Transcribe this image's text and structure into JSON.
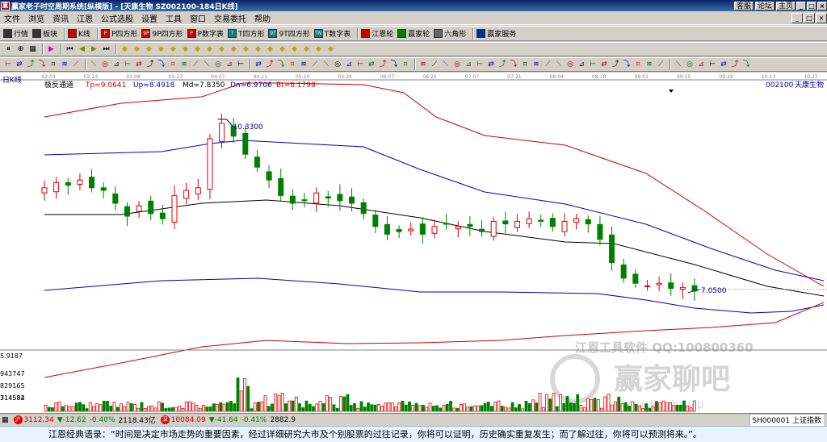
{
  "window": {
    "icon_text": "赢",
    "title": "赢家老子时空周期系统[纵横版] - [天康生物   SZ002100-184日K线]",
    "title_buttons": [
      "客服",
      "论坛",
      "主页"
    ],
    "window_controls": [
      "_",
      "□",
      "×"
    ]
  },
  "menu": {
    "items": [
      "文件",
      "浏览",
      "资讯",
      "江恩",
      "公式选股",
      "设置",
      "工具",
      "窗口",
      "交易委托",
      "帮助"
    ],
    "mdi": [
      "_",
      "□",
      "×"
    ]
  },
  "toolbar1": {
    "items": [
      {
        "label": "行情",
        "color": "#333333"
      },
      {
        "label": "板块",
        "color": "#333333"
      },
      {
        "label": "K线",
        "color": "#cc0000"
      },
      {
        "label": "P四方形",
        "color": "#cc0000",
        "abbr": "P"
      },
      {
        "label": "9P四方形",
        "color": "#cc0000",
        "abbr": "9P"
      },
      {
        "label": "P数字表",
        "color": "#cc0000",
        "abbr": "P"
      },
      {
        "label": "T四方形",
        "color": "#008080",
        "abbr": "T"
      },
      {
        "label": "9T四方形",
        "color": "#008080",
        "abbr": "9T"
      },
      {
        "label": "T数字表",
        "color": "#008080",
        "abbr": "TN"
      },
      {
        "label": "江恩轮",
        "color": "#cc0000"
      },
      {
        "label": "赢家轮",
        "color": "#008000"
      },
      {
        "label": "六角形",
        "color": "#666666"
      },
      {
        "label": "赢家服务",
        "color": "#003399"
      }
    ]
  },
  "toolbar2_icons": [
    "pause-icon",
    "zoom-icon",
    "grid-icon",
    "play-icon",
    "first-icon",
    "prev-icon",
    "next-icon",
    "last-icon",
    "diamond-icon",
    "diamond-icon",
    "diamond-icon",
    "diamond-icon",
    "diamond-icon",
    "diamond-icon",
    "diamond-icon",
    "diamond-icon",
    "diamond-icon",
    "diamond-icon",
    "diamond-icon",
    "diamond-icon",
    "diamond-icon",
    "diamond-icon",
    "diamond-icon",
    "diamond-icon",
    "diamond-icon",
    "diamond-icon"
  ],
  "chart": {
    "period_label": "日K线",
    "indicator_name": "极反通道",
    "indicator_values": [
      {
        "label": "Tp=9.0641",
        "color": "#d00000"
      },
      {
        "label": "Up=8.4918",
        "color": "#0000c0"
      },
      {
        "label": "Md=7.8350",
        "color": "#000000"
      },
      {
        "label": "Dn=6.9706",
        "color": "#0000c0"
      },
      {
        "label": "Bt=6.1798",
        "color": "#d00000"
      }
    ],
    "stock_code": "002100",
    "stock_name": "天康生物",
    "date_ticks": [
      "02-03",
      "02-23",
      "03-08",
      "03-23",
      "04-07",
      "04-21",
      "05-10",
      "05-24",
      "06-07",
      "06-21",
      "07-07",
      "07-21",
      "08-04",
      "08-18",
      "09-01",
      "09-15",
      "09-29",
      "10-13",
      "10-27"
    ],
    "high_label": "10.3300",
    "low_label": "7.0500",
    "volume_axis": [
      "5.9187",
      "943747",
      "829165",
      "714584",
      "314582"
    ],
    "watermark_line1": "江恩工具软件  QQ:100800360",
    "watermark_logo": "赢家聊吧",
    "watermark_url": "www.ijiaoba.vip"
  },
  "chart_data": {
    "type": "candlestick",
    "y_range": [
      6.0,
      11.0
    ],
    "high_marked": 10.33,
    "low_marked": 7.05,
    "channel": {
      "Tp": 9.0641,
      "Up": 8.4918,
      "Md": 7.835,
      "Dn": 6.9706,
      "Bt": 6.1798
    },
    "close_path": [
      9.05,
      9.15,
      9.1,
      9.2,
      9.05,
      9.0,
      8.75,
      8.5,
      8.7,
      8.55,
      8.45,
      8.9,
      9.0,
      9.05,
      10.0,
      10.3,
      10.05,
      9.7,
      9.45,
      9.2,
      8.9,
      8.75,
      8.8,
      8.95,
      8.85,
      8.8,
      8.75,
      8.55,
      8.3,
      8.15,
      8.2,
      8.25,
      8.15,
      8.3,
      8.35,
      8.3,
      8.3,
      8.2,
      8.4,
      8.35,
      8.4,
      8.45,
      8.4,
      8.3,
      8.4,
      8.45,
      8.35,
      8.05,
      7.6,
      7.3,
      7.2,
      7.15,
      7.2,
      7.1,
      7.12,
      7.05
    ]
  },
  "status": {
    "idx1_value": "3112.34",
    "idx1_change": "▼-12.62",
    "idx1_pct": "-0.40%",
    "idx1_amount": "2118.43亿",
    "idx2_value": "10084.09",
    "idx2_change": "▼-41.64",
    "idx2_pct": "-0.41%",
    "idx2_amount": "2882.9",
    "badge1": "沪",
    "badge2": "深",
    "right_code": "SH000001",
    "right_name": "上证指数"
  },
  "quote": "江恩经典语录：“时间是决定市场走势的重要因素，经过详细研究大市及个别股票的过往记录，你将可以证明，历史确实重复发生；而了解过往，你将可以预测将来。”。"
}
